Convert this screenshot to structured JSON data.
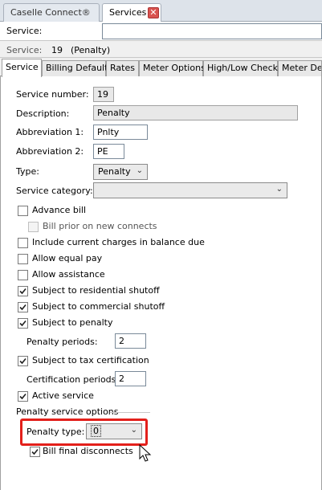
{
  "doc_tabs": [
    {
      "label": "Caselle Connect®"
    },
    {
      "label": "Services"
    }
  ],
  "search": {
    "label": "Service:",
    "value": ""
  },
  "info": {
    "label": "Service:",
    "number": "19",
    "name": "(Penalty)"
  },
  "tabs": [
    "Service",
    "Billing Defaults",
    "Rates",
    "Meter Options",
    "High/Low Checks",
    "Meter Def"
  ],
  "form": {
    "service_number": {
      "label": "Service number:",
      "value": "19"
    },
    "description": {
      "label": "Description:",
      "value": "Penalty"
    },
    "abbr1": {
      "label": "Abbreviation 1:",
      "value": "Pnlty"
    },
    "abbr2": {
      "label": "Abbreviation 2:",
      "value": "PE"
    },
    "type": {
      "label": "Type:",
      "value": "Penalty"
    },
    "category": {
      "label": "Service category:",
      "value": ""
    },
    "checkboxes": [
      {
        "label": "Advance bill",
        "checked": false
      },
      {
        "label": "Bill prior on new connects",
        "checked": false,
        "disabled": true
      },
      {
        "label": "Include current charges in balance due",
        "checked": false
      },
      {
        "label": "Allow equal pay",
        "checked": false
      },
      {
        "label": "Allow assistance",
        "checked": false
      },
      {
        "label": "Subject to residential shutoff",
        "checked": true
      },
      {
        "label": "Subject to commercial shutoff",
        "checked": true
      },
      {
        "label": "Subject to penalty",
        "checked": true
      }
    ],
    "penalty_periods": {
      "label": "Penalty periods:",
      "value": "2"
    },
    "tax_cert": {
      "label": "Subject to tax certification",
      "checked": true
    },
    "cert_periods": {
      "label": "Certification periods:",
      "value": "2"
    },
    "active": {
      "label": "Active service",
      "checked": true
    },
    "penalty_options_group": "Penalty service options",
    "penalty_type": {
      "label": "Penalty type:",
      "value": "0"
    },
    "bill_final": {
      "label": "Bill final disconnects",
      "checked": true
    }
  }
}
